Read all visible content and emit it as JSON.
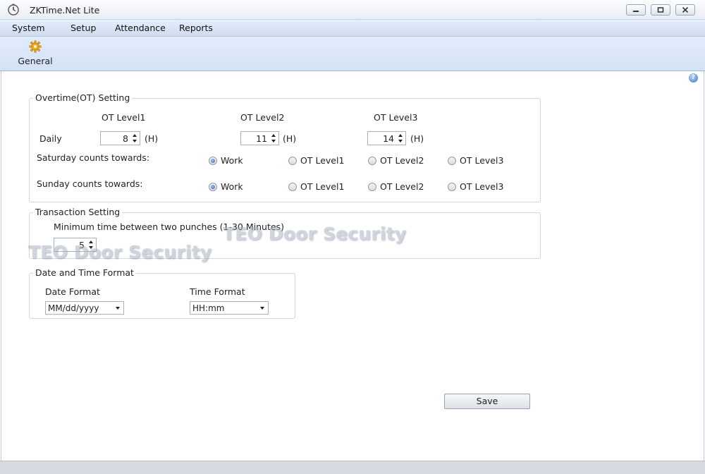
{
  "window": {
    "title": "ZKTime.Net Lite",
    "controls": {
      "minimize_icon": "minimize-icon",
      "maximize_icon": "maximize-icon",
      "close_icon": "close-icon"
    }
  },
  "menu": {
    "items": [
      "System",
      "Setup",
      "Attendance",
      "Reports"
    ]
  },
  "toolbar": {
    "general_label": "General"
  },
  "overtime": {
    "legend": "Overtime(OT) Setting",
    "level_headers": [
      "OT Level1",
      "OT Level2",
      "OT Level3"
    ],
    "daily_label": "Daily",
    "daily_values": [
      "8",
      "11",
      "14"
    ],
    "unit": "(H)",
    "saturday_label": "Saturday counts towards:",
    "sunday_label": "Sunday counts towards:",
    "options": [
      "Work",
      "OT Level1",
      "OT Level2",
      "OT Level3"
    ],
    "saturday_selected": "Work",
    "sunday_selected": "Work"
  },
  "transaction": {
    "legend": "Transaction Setting",
    "min_label": "Minimum time between two punches (1-30 Minutes)",
    "min_value": "5"
  },
  "datetime": {
    "legend": "Date and Time Format",
    "date_label": "Date Format",
    "date_value": "MM/dd/yyyy",
    "time_label": "Time Format",
    "time_value": "HH:mm"
  },
  "watermarks": [
    "TEO Door Security",
    "TEO Door Security"
  ],
  "actions": {
    "save_label": "Save"
  },
  "colors": {
    "menubar": "#d5e2f4",
    "radio_selected": "#2a64b8"
  }
}
